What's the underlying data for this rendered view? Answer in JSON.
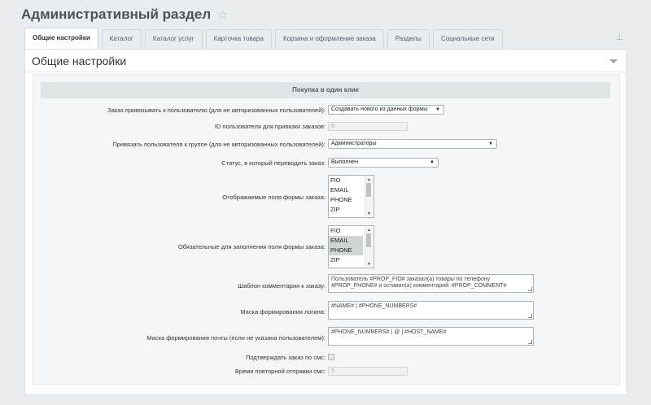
{
  "page": {
    "title": "Административный раздел",
    "star_icon": "star-icon"
  },
  "tabs": [
    {
      "label": "Общие настройки",
      "active": true
    },
    {
      "label": "Каталог"
    },
    {
      "label": "Каталог услуг"
    },
    {
      "label": "Карточка товара"
    },
    {
      "label": "Корзина и оформление заказа"
    },
    {
      "label": "Разделы"
    },
    {
      "label": "Социальные сети"
    }
  ],
  "panel": {
    "title": "Общие настройки"
  },
  "section": {
    "title": "Покупка в один клик"
  },
  "fields": {
    "bind_user": {
      "label": "Заказ привязывать к пользователю (для не авторизованных пользователей):",
      "value": "Создавать нового из данных формы"
    },
    "user_id": {
      "label": "ID пользователя для привязки заказов:",
      "value": "5"
    },
    "bind_group": {
      "label": "Привязать пользователя к группе (для не авторизованных пользователей):",
      "value": "Администраторы"
    },
    "status": {
      "label": "Статус, в который переводить заказ:",
      "value": "Выполнен"
    },
    "display_fields": {
      "label": "Отображаемые поля формы заказа:",
      "options": [
        "FIO",
        "EMAIL",
        "PHONE",
        "ZIP"
      ]
    },
    "required_fields": {
      "label": "Обязательные для заполнения поля формы заказа:",
      "options": [
        "FIO",
        "EMAIL",
        "PHONE",
        "ZIP"
      ],
      "selected": [
        "EMAIL",
        "PHONE"
      ]
    },
    "comment_template": {
      "label": "Шаблон комментария к заказу:",
      "line1": "Пользователь #PROP_FIO# заказал(а) товары по телефону",
      "line2": "#PROP_PHONE# и оставил(а) комментарий: #PROP_COMMENT#"
    },
    "login_mask": {
      "label": "Маска формирования логина:",
      "value": "#NAME# | #PHONE_NUMBERS#"
    },
    "email_mask": {
      "label": "Маска формирования почты (если не указана пользователем):",
      "value": "#PHONE_NUMBERS# | @ | #HOST_NAME#"
    },
    "sms_confirm": {
      "label": "Подтверждать заказ по смс:",
      "checked": false
    },
    "sms_resend": {
      "label": "Время повторной отправки смс:",
      "value": "5"
    }
  },
  "icons": {
    "pin": "pin-icon",
    "collapse": "chevron-down-icon",
    "dropdown": "dropdown-arrow-icon"
  }
}
